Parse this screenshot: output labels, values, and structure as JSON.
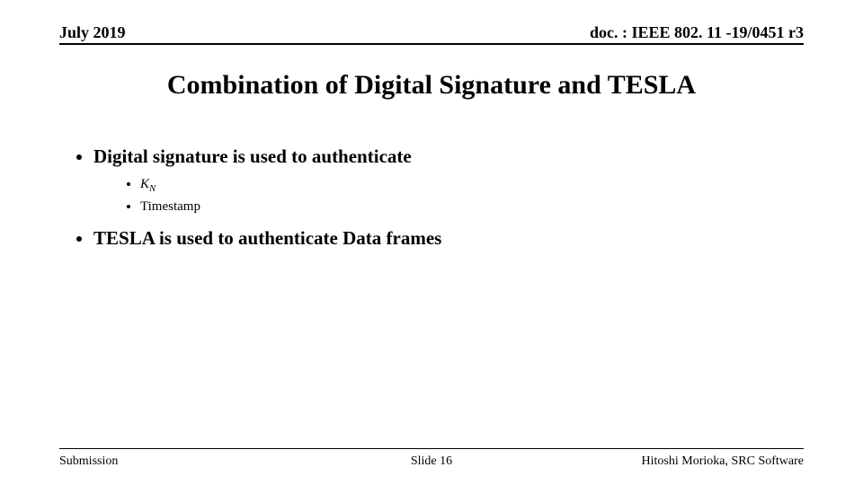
{
  "header": {
    "date": "July 2019",
    "docref": "doc. : IEEE 802. 11 -19/0451 r3"
  },
  "title": "Combination of Digital Signature and TESLA",
  "bullets": {
    "b1": "Digital signature is used to authenticate",
    "b1a_base": "K",
    "b1a_sub": "N",
    "b1b": "Timestamp",
    "b2": "TESLA is used to authenticate Data frames"
  },
  "footer": {
    "left": "Submission",
    "center": "Slide 16",
    "right": "Hitoshi Morioka, SRC Software"
  }
}
